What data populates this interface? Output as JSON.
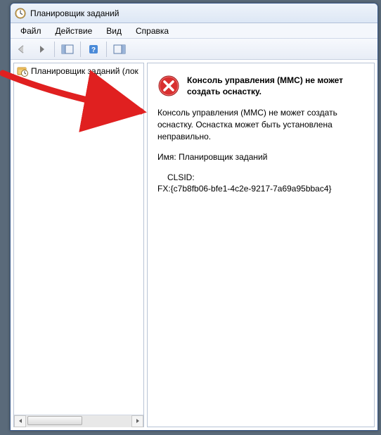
{
  "window": {
    "title": "Планировщик заданий"
  },
  "menu": {
    "file": "Файл",
    "action": "Действие",
    "view": "Вид",
    "help": "Справка"
  },
  "tree": {
    "root": "Планировщик заданий (лок"
  },
  "error": {
    "title": "Консоль управления (MMC) не может создать оснастку.",
    "body": "Консоль управления (MMC) не может создать оснастку. Оснастка может быть установлена неправильно.",
    "name_label": "Имя:",
    "name_value": "Планировщик заданий",
    "clsid_label": "CLSID:",
    "clsid_value": "FX:{c7b8fb06-bfe1-4c2e-9217-7a69a95bbac4}"
  }
}
